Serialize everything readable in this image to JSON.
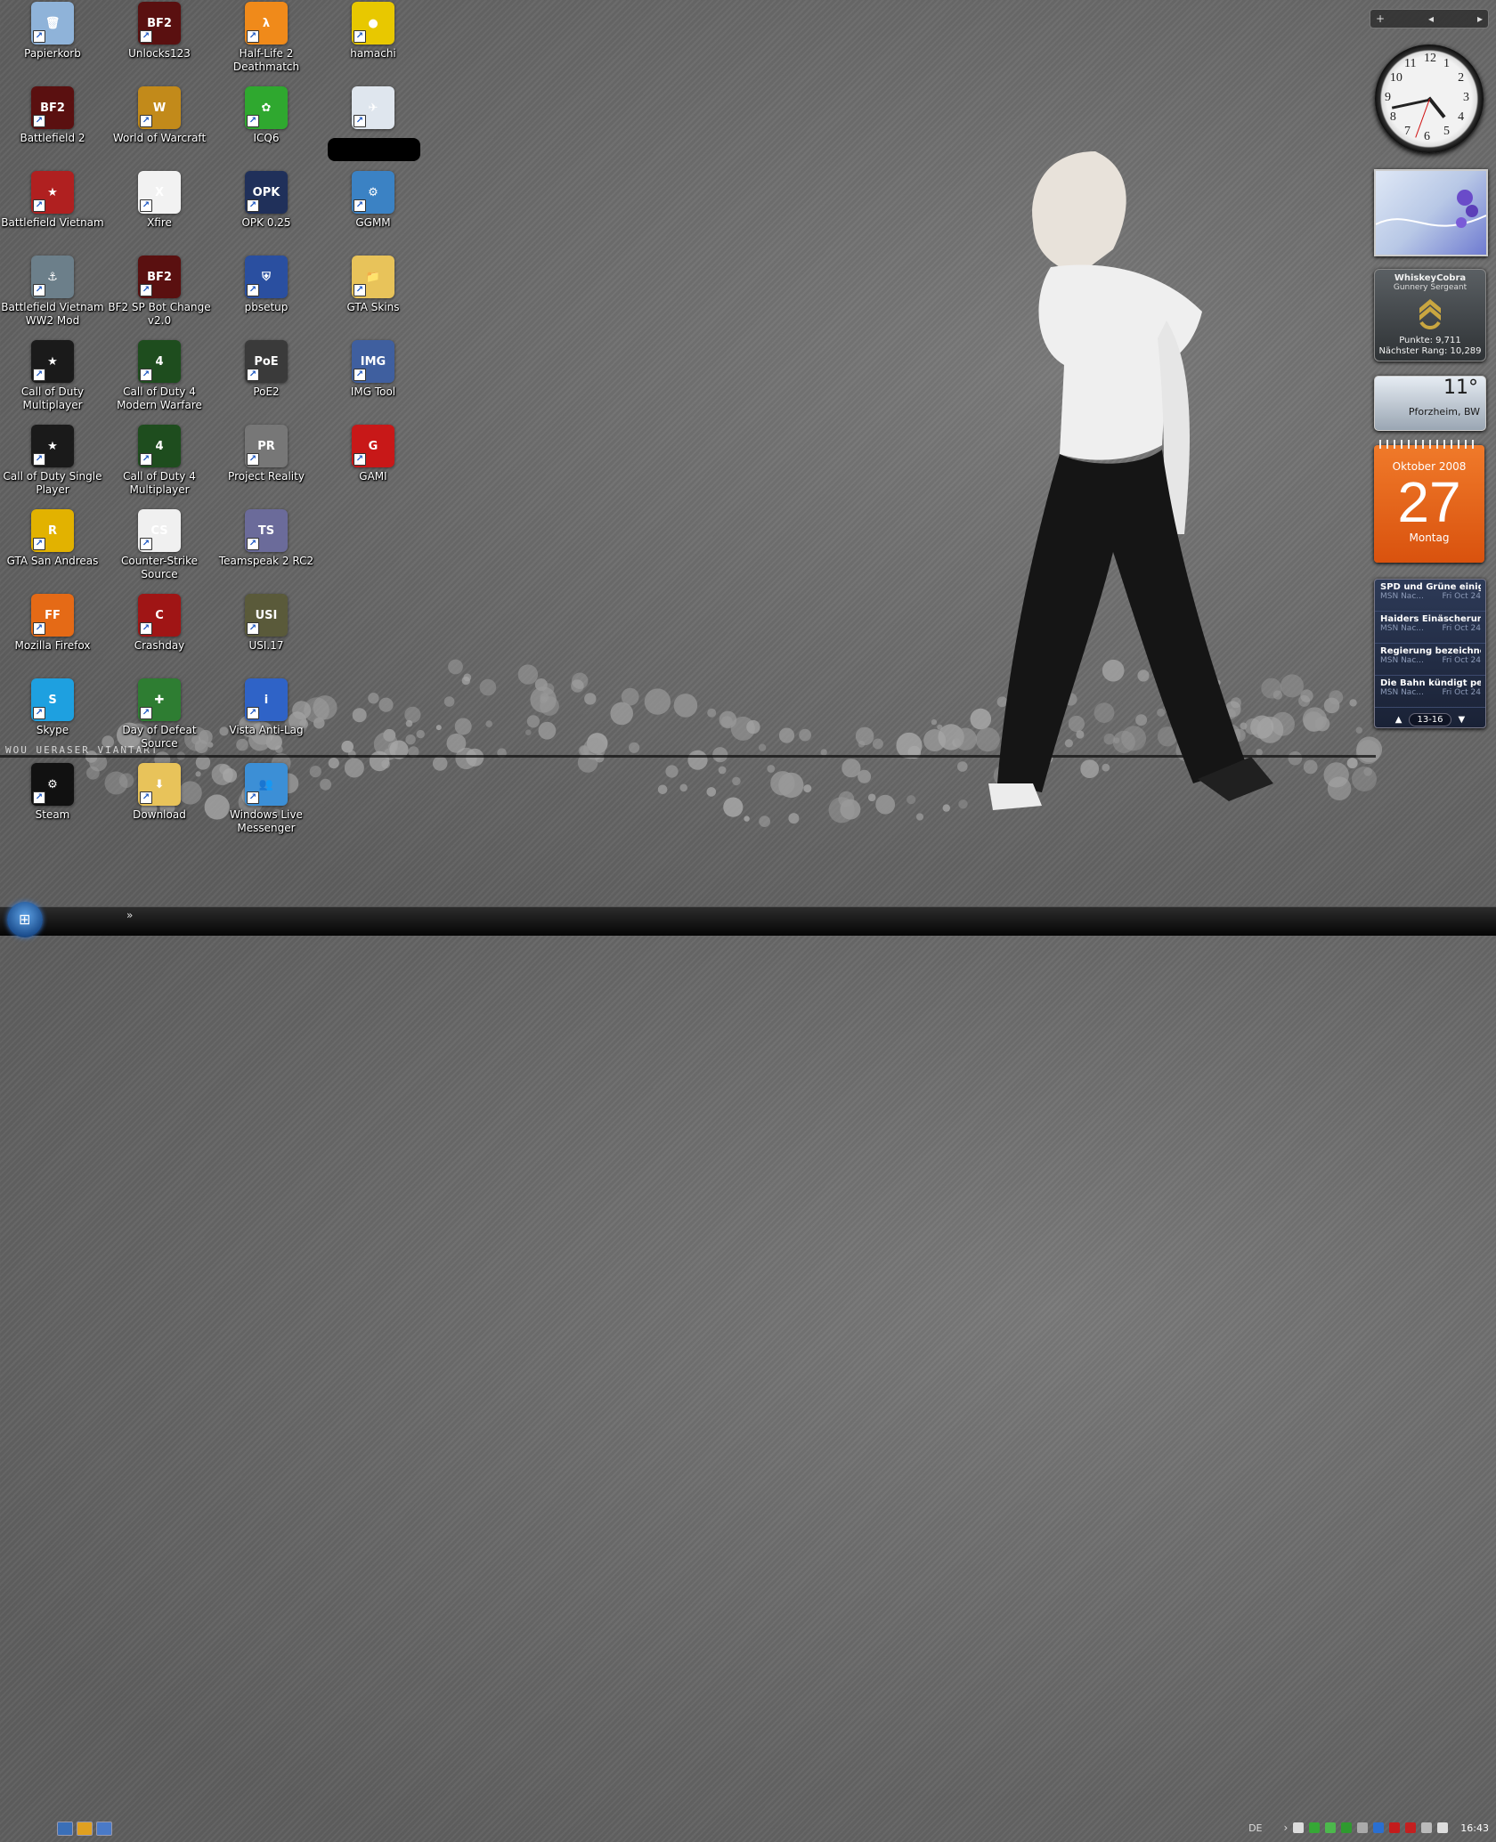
{
  "desktop": {
    "icons": [
      {
        "label": "Papierkorb",
        "icon": "recycle-bin-icon",
        "color": "#8fb3d9",
        "mark": "🗑"
      },
      {
        "label": "Battlefield 2",
        "icon": "battlefield2-icon",
        "color": "#5a1010",
        "mark": "BF2"
      },
      {
        "label": "Battlefield Vietnam",
        "icon": "battlefield-vietnam-icon",
        "color": "#b02020",
        "mark": "★"
      },
      {
        "label": "Battlefield Vietnam WW2 Mod",
        "icon": "ww2-mod-icon",
        "color": "#6c7f8a",
        "mark": "⚓"
      },
      {
        "label": "Call of Duty Multiplayer",
        "icon": "call-of-duty-icon",
        "color": "#1a1a1a",
        "mark": "★"
      },
      {
        "label": "Call of Duty Single Player",
        "icon": "call-of-duty-icon",
        "color": "#1a1a1a",
        "mark": "★"
      },
      {
        "label": "GTA San Andreas",
        "icon": "gta-icon",
        "color": "#e2b200",
        "mark": "R"
      },
      {
        "label": "Mozilla Firefox",
        "icon": "firefox-icon",
        "color": "#e56a16",
        "mark": "FF"
      },
      {
        "label": "Skype",
        "icon": "skype-icon",
        "color": "#1ea0e0",
        "mark": "S"
      },
      {
        "label": "Steam",
        "icon": "steam-icon",
        "color": "#111111",
        "mark": "⚙"
      },
      {
        "label": "Unlocks123",
        "icon": "battlefield2-icon",
        "color": "#5a1010",
        "mark": "BF2"
      },
      {
        "label": "World of Warcraft",
        "icon": "wow-icon",
        "color": "#c28a1a",
        "mark": "W"
      },
      {
        "label": "Xfire",
        "icon": "xfire-icon",
        "color": "#f2f2f2",
        "mark": "X"
      },
      {
        "label": "BF2 SP Bot Change v2.0",
        "icon": "battlefield2-icon",
        "color": "#5a1010",
        "mark": "BF2"
      },
      {
        "label": "Call of Duty 4 Modern Warfare",
        "icon": "cod4-icon",
        "color": "#1e4d1e",
        "mark": "4"
      },
      {
        "label": "Call of Duty 4 Multiplayer",
        "icon": "cod4-icon",
        "color": "#1e4d1e",
        "mark": "4"
      },
      {
        "label": "Counter-Strike Source",
        "icon": "counter-strike-icon",
        "color": "#f0f0f0",
        "mark": "CS"
      },
      {
        "label": "Crashday",
        "icon": "crashday-icon",
        "color": "#a01515",
        "mark": "C"
      },
      {
        "label": "Day of Defeat Source",
        "icon": "day-of-defeat-icon",
        "color": "#2e7d32",
        "mark": "✚"
      },
      {
        "label": "Download",
        "icon": "folder-icon",
        "color": "#e8c35a",
        "mark": "⬇"
      },
      {
        "label": "Half-Life 2 Deathmatch",
        "icon": "half-life-icon",
        "color": "#f08a1a",
        "mark": "λ"
      },
      {
        "label": "ICQ6",
        "icon": "icq-icon",
        "color": "#2fa82f",
        "mark": "✿"
      },
      {
        "label": "OPK 0.25",
        "icon": "opk-icon",
        "color": "#20305a",
        "mark": "OPK"
      },
      {
        "label": "pbsetup",
        "icon": "pbsetup-icon",
        "color": "#2a4fa0",
        "mark": "⛨"
      },
      {
        "label": "PoE2",
        "icon": "poe-icon",
        "color": "#3a3a3a",
        "mark": "PoE"
      },
      {
        "label": "Project Reality",
        "icon": "project-reality-icon",
        "color": "#777777",
        "mark": "PR"
      },
      {
        "label": "Teamspeak 2 RC2",
        "icon": "teamspeak-icon",
        "color": "#6b6b9a",
        "mark": "TS"
      },
      {
        "label": "USI.17",
        "icon": "usi-icon",
        "color": "#5a5a3a",
        "mark": "USI"
      },
      {
        "label": "Vista Anti-Lag",
        "icon": "anti-lag-icon",
        "color": "#2f63c7",
        "mark": "i"
      },
      {
        "label": "Windows Live Messenger",
        "icon": "messenger-icon",
        "color": "#3c8fd6",
        "mark": "👥"
      },
      {
        "label": "hamachi",
        "icon": "hamachi-icon",
        "color": "#e8c800",
        "mark": "●"
      },
      {
        "label": "",
        "icon": "jet-image-icon",
        "color": "#dfe6ee",
        "mark": "✈"
      },
      {
        "label": "GGMM",
        "icon": "ggmm-icon",
        "color": "#3b82c4",
        "mark": "⚙"
      },
      {
        "label": "GTA Skins",
        "icon": "folder-icon",
        "color": "#e8c35a",
        "mark": "📁"
      },
      {
        "label": "IMG Tool",
        "icon": "img-tool-icon",
        "color": "#3f5f9f",
        "mark": "IMG"
      },
      {
        "label": "GAMI",
        "icon": "gami-icon",
        "color": "#c81818",
        "mark": "G"
      }
    ]
  },
  "wallpaper": {
    "watermark": "WOU  UERASER  VIANTART"
  },
  "gadgets": {
    "sidebar_controls": {
      "add": "+",
      "prev": "◂",
      "next": "▸"
    },
    "clock": {
      "numbers": [
        "12",
        "1",
        "2",
        "3",
        "4",
        "5",
        "6",
        "7",
        "8",
        "9",
        "10",
        "11"
      ],
      "hour": 4,
      "minute": 43
    },
    "rank": {
      "name": "WhiskeyCobra",
      "rank": "Gunnery Sergeant",
      "points": "Punkte: 9,711",
      "next": "Nächster Rang: 10,289"
    },
    "weather": {
      "temp": "11°",
      "city": "Pforzheim, BW"
    },
    "calendar": {
      "month": "Oktober 2008",
      "day": "27",
      "weekday": "Montag"
    },
    "news": {
      "items": [
        {
          "headline": "SPD und Grüne einig...",
          "source": "MSN Nac...",
          "date": "Fri Oct 24"
        },
        {
          "headline": "Haiders Einäscherun...",
          "source": "MSN Nac...",
          "date": "Fri Oct 24"
        },
        {
          "headline": "Regierung bezeichne...",
          "source": "MSN Nac...",
          "date": "Fri Oct 24"
        },
        {
          "headline": "Die Bahn kündigt per...",
          "source": "MSN Nac...",
          "date": "Fri Oct 24"
        }
      ],
      "page": "13-16",
      "up": "▲",
      "down": "▼"
    }
  },
  "taskbar": {
    "start_glyph": "⊞",
    "overflow": "»",
    "language": "DE",
    "tray_arrow": "›",
    "time": "16:43"
  }
}
